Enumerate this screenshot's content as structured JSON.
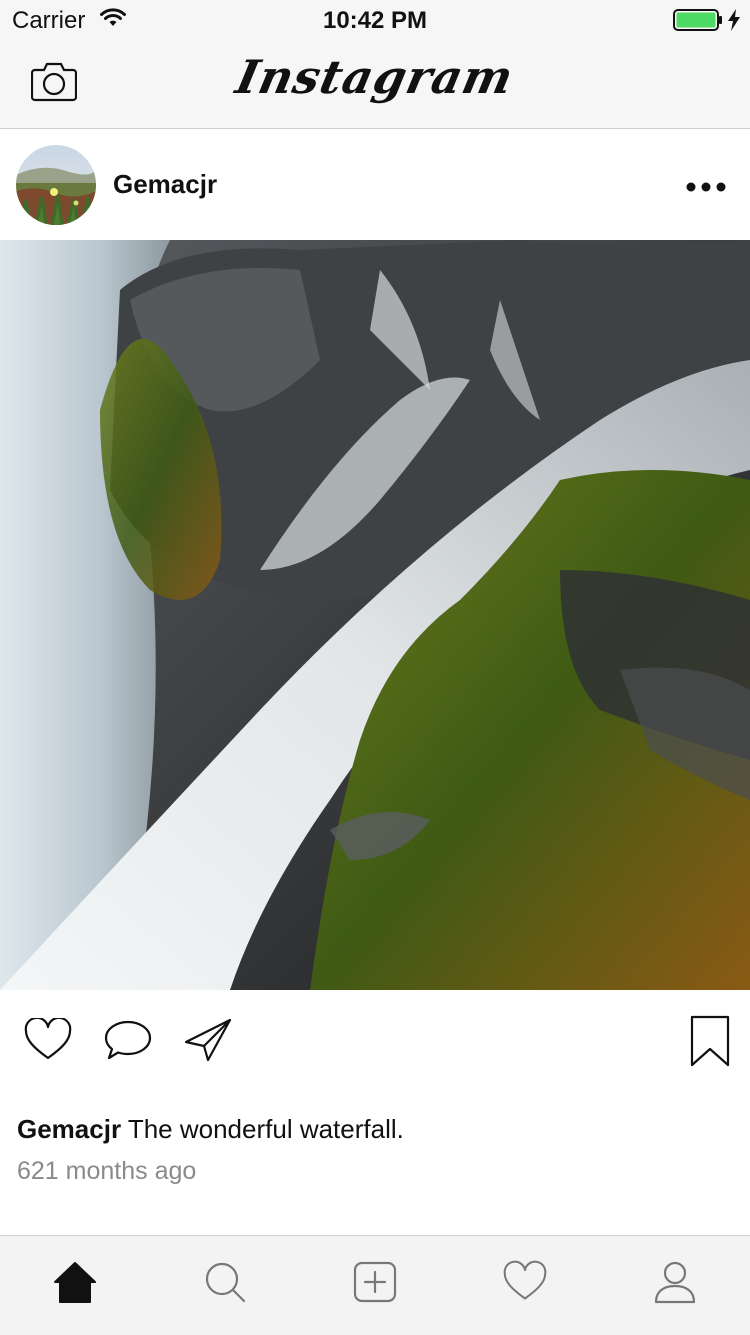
{
  "status_bar": {
    "carrier": "Carrier",
    "time": "10:42 PM",
    "battery_color": "#4cd964"
  },
  "nav": {
    "title": "Instagram",
    "left_icon": "camera-icon"
  },
  "post": {
    "username": "Gemacjr",
    "more_icon": "more-dots-icon",
    "photo_description_icon": "waterfall-photo",
    "actions": {
      "left": [
        "heart-icon",
        "comment-icon",
        "share-icon"
      ],
      "right": "bookmark-icon"
    },
    "caption_user": "Gemacjr",
    "caption_text": " The wonderful waterfall.",
    "timestamp": "621 months ago"
  },
  "tab_bar": {
    "tabs": [
      "home-icon",
      "search-icon",
      "add-post-icon",
      "activity-heart-icon",
      "profile-icon"
    ],
    "active": "home-icon"
  }
}
